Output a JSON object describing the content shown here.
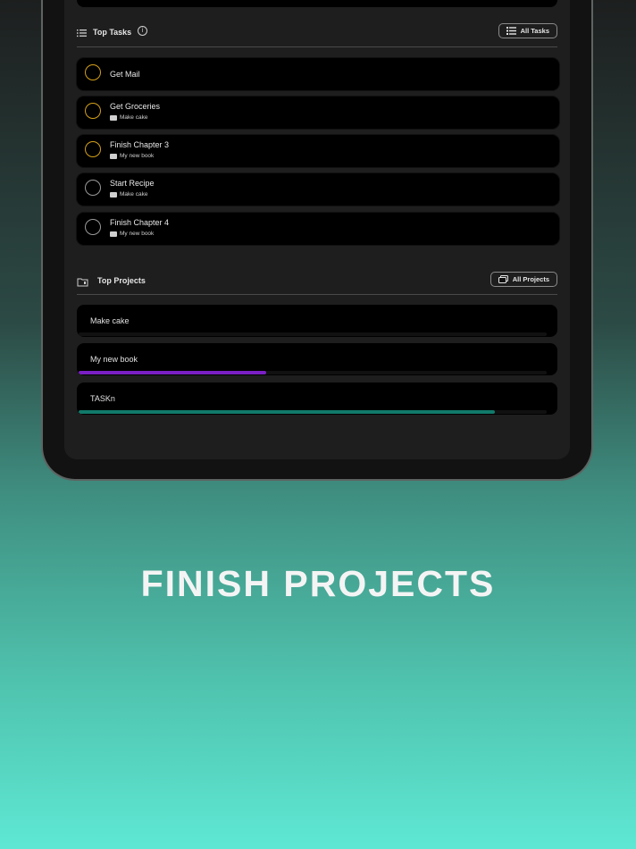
{
  "top_tasks": {
    "title": "Top Tasks",
    "all_button_label": "All Tasks",
    "items": [
      {
        "name": "Get Mail",
        "project": "",
        "status": "pending"
      },
      {
        "name": "Get Groceries",
        "project": "Make cake",
        "status": "pending"
      },
      {
        "name": "Finish Chapter 3",
        "project": "My new book",
        "status": "pending"
      },
      {
        "name": "Start Recipe",
        "project": "Make cake",
        "status": "open"
      },
      {
        "name": "Finish Chapter 4",
        "project": "My new book",
        "status": "open"
      }
    ]
  },
  "top_projects": {
    "title": "Top Projects",
    "all_button_label": "All Projects",
    "items": [
      {
        "name": "Make cake",
        "progress": 0,
        "color": "#000000"
      },
      {
        "name": "My new book",
        "progress": 0.4,
        "color": "#7a1fc4"
      },
      {
        "name": "TASKn",
        "progress": 0.89,
        "color": "#117a6a"
      }
    ]
  },
  "colors": {
    "task_pending": "#d4a017",
    "task_open": "#9a9a9a"
  },
  "caption": "FINISH PROJECTS"
}
